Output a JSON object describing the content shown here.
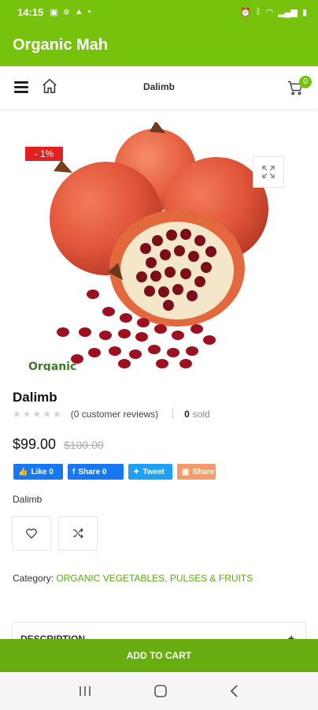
{
  "status_bar": {
    "time": "14:15",
    "left_icons": [
      "image-icon",
      "gear-icon",
      "drive-icon",
      "dot-icon"
    ],
    "right_icons": [
      "alarm-icon",
      "bluetooth-icon",
      "wifi-icon",
      "signal-icon",
      "battery-icon"
    ]
  },
  "app_bar": {
    "title": "Organic Mah"
  },
  "nav_bar": {
    "page_title": "Dalimb",
    "cart_count": "0"
  },
  "product": {
    "sale_badge": "- 1%",
    "name": "Dalimb",
    "rating_stars": "★★★★★",
    "reviews_text": "(0 customer reviews)",
    "sold_count": "0",
    "sold_label": "sold",
    "price_current": "$99.00",
    "price_old": "$100.00",
    "short_description": "Dalimb",
    "category_label": "Category:",
    "category_value": "ORGANIC VEGETABLES, PULSES & FRUITS",
    "watermark": "Organic"
  },
  "share": {
    "like": "Like 0",
    "share": "Share 0",
    "tweet": "Tweet",
    "ext": "Share"
  },
  "description_panel": {
    "label": "DESCRIPTION",
    "toggle": "+"
  },
  "add_to_cart": {
    "label": "ADD TO CART"
  },
  "colors": {
    "brand_green": "#76c20c",
    "button_green": "#67ad10",
    "sale_red": "#e12121",
    "facebook_blue": "#1877f2",
    "twitter_blue": "#1da1f2"
  }
}
